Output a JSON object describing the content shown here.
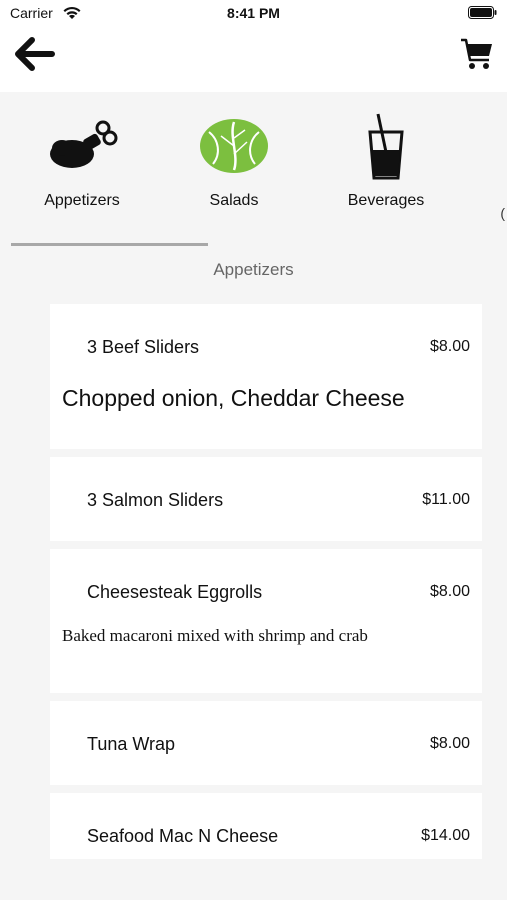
{
  "status": {
    "carrier": "Carrier",
    "time": "8:41 PM"
  },
  "nav": {
    "back_icon": "arrow-left-icon",
    "cart_icon": "shopping-cart-icon"
  },
  "categories": [
    {
      "label": "Appetizers",
      "icon": "drumstick-icon"
    },
    {
      "label": "Salads",
      "icon": "lettuce-icon"
    },
    {
      "label": "Beverages",
      "icon": "drink-glass-icon"
    }
  ],
  "overflow_glyph": "(",
  "section_title": "Appetizers",
  "menu_items": [
    {
      "name": "3 Beef Sliders",
      "price": "$8.00",
      "description": "Chopped onion, Cheddar Cheese"
    },
    {
      "name": "3 Salmon Sliders",
      "price": "$11.00"
    },
    {
      "name": "Cheesesteak Eggrolls",
      "price": "$8.00",
      "description": "Baked macaroni mixed with shrimp and crab"
    },
    {
      "name": "Tuna Wrap",
      "price": "$8.00"
    },
    {
      "name": "Seafood Mac N Cheese",
      "price": "$14.00"
    }
  ],
  "colors": {
    "salad_green": "#7cbf3f",
    "background": "#f5f5f5",
    "card": "#ffffff"
  }
}
